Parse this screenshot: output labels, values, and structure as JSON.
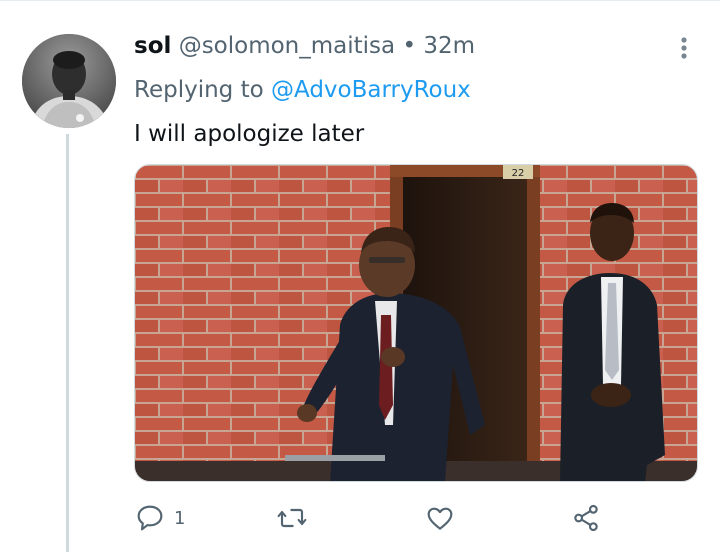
{
  "tweet": {
    "display_name": "sol",
    "handle": "@solomon_maitisa",
    "separator": "•",
    "time": "32m",
    "replying_prefix": "Replying to",
    "replying_to": "@AdvoBarryRoux",
    "text": "I will apologize later",
    "photo_door_number": "22"
  },
  "actions": {
    "reply_count": "1"
  },
  "icons": {
    "more": "more-vertical-icon",
    "reply": "reply-icon",
    "retweet": "retweet-icon",
    "like": "heart-icon",
    "share": "share-icon"
  },
  "colors": {
    "text_primary": "#0f1419",
    "text_secondary": "#536471",
    "link": "#1d9bf0"
  }
}
